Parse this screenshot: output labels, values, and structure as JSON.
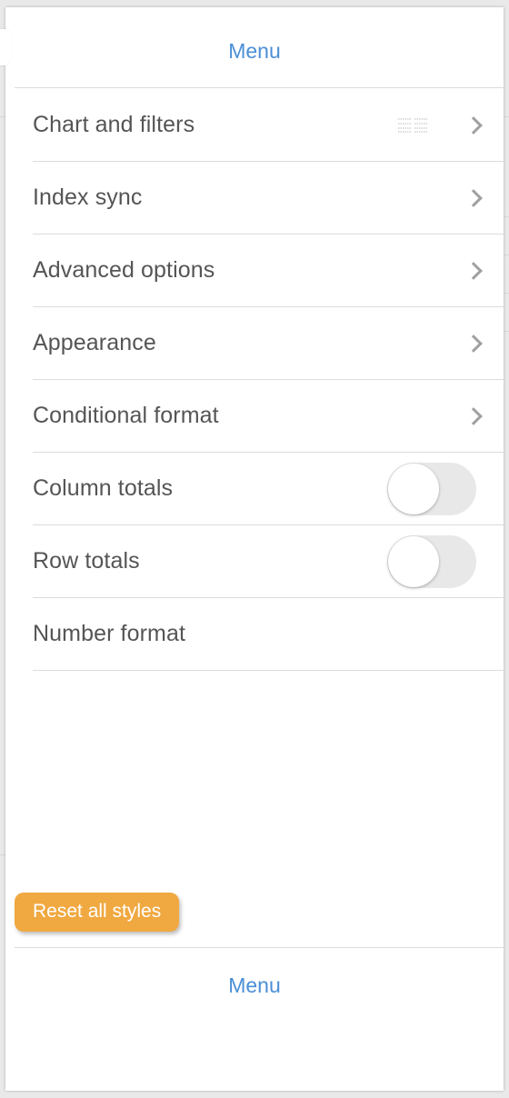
{
  "header": {
    "title": "Menu"
  },
  "menu": {
    "items": [
      {
        "label": "Chart and filters",
        "control": "chevron",
        "extra_icon": "grid-icon"
      },
      {
        "label": "Index sync",
        "control": "chevron"
      },
      {
        "label": "Advanced options",
        "control": "chevron"
      },
      {
        "label": "Appearance",
        "control": "chevron"
      },
      {
        "label": "Conditional format",
        "control": "chevron"
      },
      {
        "label": "Column totals",
        "control": "toggle",
        "on": false
      },
      {
        "label": "Row totals",
        "control": "toggle",
        "on": false
      },
      {
        "label": "Number format",
        "control": "none"
      }
    ]
  },
  "actions": {
    "reset_label": "Reset all styles"
  },
  "footer": {
    "label": "Menu"
  },
  "colors": {
    "accent": "#4a8fd6",
    "reset_button": "#f0a840"
  }
}
